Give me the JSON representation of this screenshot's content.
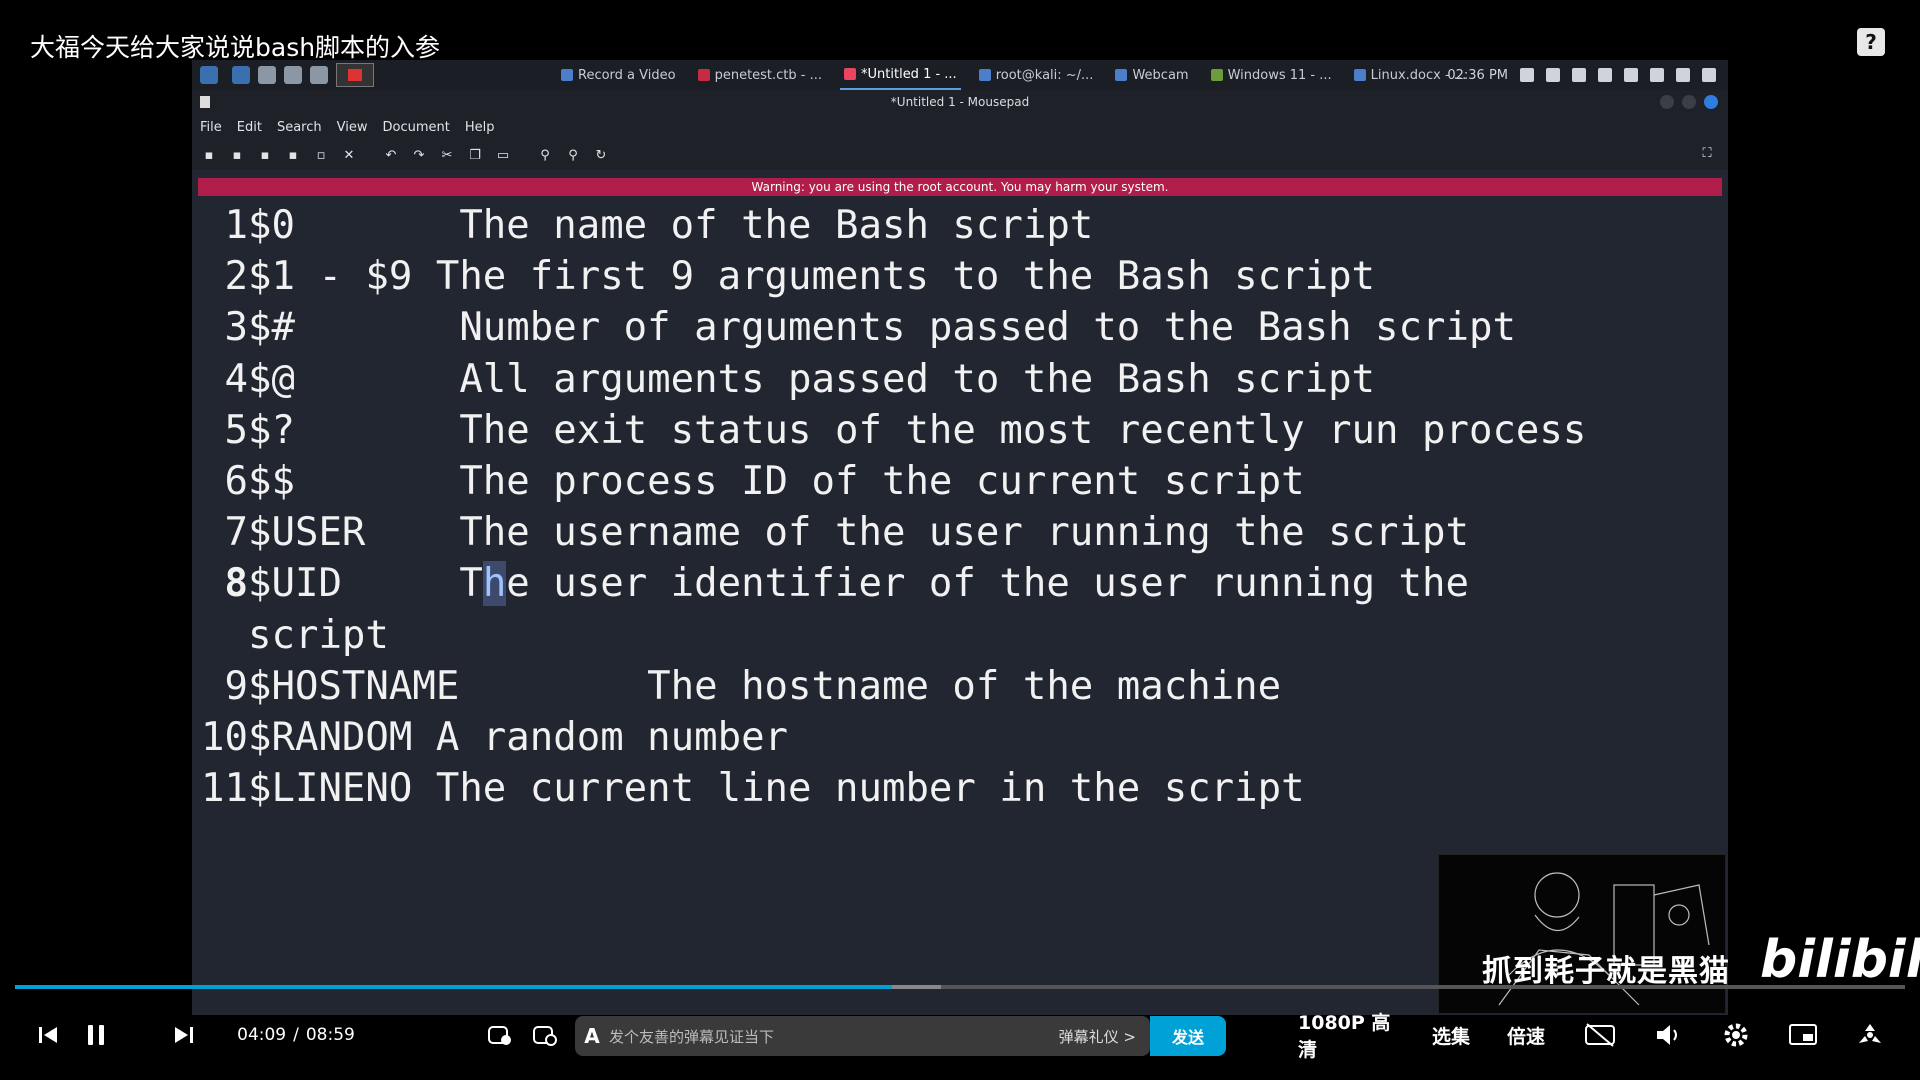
{
  "video_title": "大福今天给大家说说bash脚本的入参",
  "help_icon": "?",
  "taskbar": {
    "tasks": [
      {
        "label": "Record a Video",
        "icon": "record-icon"
      },
      {
        "label": "penetest.ctb - ...",
        "icon": "cherrytree-icon"
      },
      {
        "label": "*Untitled 1 - ...",
        "icon": "mousepad-icon",
        "active": true
      },
      {
        "label": "root@kali: ~/...",
        "icon": "terminal-icon"
      },
      {
        "label": "Webcam",
        "icon": "webcam-icon"
      },
      {
        "label": "Windows 11 - ...",
        "icon": "vm-icon"
      },
      {
        "label": "Linux.docx - ...",
        "icon": "docx-icon"
      }
    ],
    "clock": "02:36 PM"
  },
  "window": {
    "title": "*Untitled 1 - Mousepad",
    "menu": [
      "File",
      "Edit",
      "Search",
      "View",
      "Document",
      "Help"
    ],
    "warning": "Warning: you are using the root account. You may harm your system."
  },
  "editor": {
    "lines": [
      {
        "num": "1",
        "text": "$0       The name of the Bash script"
      },
      {
        "num": "2",
        "text": "$1 - $9 The first 9 arguments to the Bash script"
      },
      {
        "num": "3",
        "text": "$#       Number of arguments passed to the Bash script"
      },
      {
        "num": "4",
        "text": "$@       All arguments passed to the Bash script"
      },
      {
        "num": "5",
        "text": "$?       The exit status of the most recently run process"
      },
      {
        "num": "6",
        "text": "$$       The process ID of the current script"
      },
      {
        "num": "7",
        "text": "$USER    The username of the user running the script"
      },
      {
        "num": "8",
        "text_before": "$UID     T",
        "text_cursor": "h",
        "text_after": "e user identifier of the user running the",
        "current": true
      },
      {
        "num": "",
        "text": "script"
      },
      {
        "num": "9",
        "text": "$HOSTNAME        The hostname of the machine"
      },
      {
        "num": "10",
        "text": "$RANDOM A random number"
      },
      {
        "num": "11",
        "text": "$LINENO The current line number in the script"
      }
    ]
  },
  "overlay": {
    "watermark": "抓到耗子就是黑猫",
    "brand": "bilibili"
  },
  "player": {
    "progress": 0.464,
    "buffered_to": 0.49,
    "current_time": "04:09",
    "separator": "/",
    "duration": "08:59",
    "danmaku_placeholder": "发个友善的弹幕见证当下",
    "danmaku_etiquette": "弹幕礼仪 >",
    "send": "发送",
    "quality": "1080P 高清",
    "episodes": "选集",
    "speed": "倍速"
  }
}
